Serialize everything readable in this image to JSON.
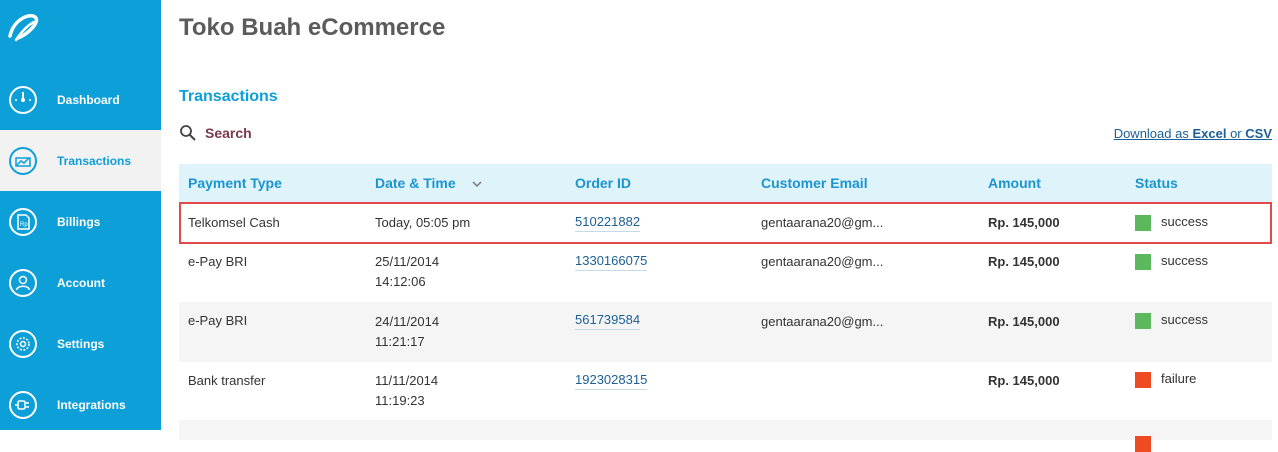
{
  "app": {
    "logo_icon": "swirl-logo-icon",
    "title": "Toko Buah eCommerce"
  },
  "sidebar": {
    "items": [
      {
        "label": "Dashboard",
        "icon": "gauge-icon",
        "active": false
      },
      {
        "label": "Transactions",
        "icon": "trend-chart-icon",
        "active": true
      },
      {
        "label": "Billings",
        "icon": "bill-icon",
        "active": false
      },
      {
        "label": "Account",
        "icon": "user-icon",
        "active": false
      },
      {
        "label": "Settings",
        "icon": "gear-icon",
        "active": false
      },
      {
        "label": "Integrations",
        "icon": "plug-icon",
        "active": false
      }
    ]
  },
  "main": {
    "section_title": "Transactions",
    "search_label": "Search",
    "download": {
      "prefix": "Download as",
      "excel": "Excel",
      "or": "or",
      "csv": "CSV"
    }
  },
  "table": {
    "columns": [
      "Payment Type",
      "Date & Time",
      "Order ID",
      "Customer Email",
      "Amount",
      "Status"
    ],
    "sorted_column": "Date & Time",
    "rows": [
      {
        "payment_type": "Telkomsel Cash",
        "date": "Today, 05:05 pm",
        "time": "",
        "order_id": "510221882",
        "email": "gentaarana20@gm...",
        "amount": "Rp. 145,000",
        "status": "success"
      },
      {
        "payment_type": "e-Pay BRI",
        "date": "25/11/2014",
        "time": "14:12:06",
        "order_id": "1330166075",
        "email": "gentaarana20@gm...",
        "amount": "Rp. 145,000",
        "status": "success"
      },
      {
        "payment_type": "e-Pay BRI",
        "date": "24/11/2014",
        "time": "11:21:17",
        "order_id": "561739584",
        "email": "gentaarana20@gm...",
        "amount": "Rp. 145,000",
        "status": "success"
      },
      {
        "payment_type": "Bank transfer",
        "date": "11/11/2014",
        "time": "11:19:23",
        "order_id": "1923028315",
        "email": "",
        "amount": "Rp. 145,000",
        "status": "failure"
      }
    ]
  },
  "colors": {
    "sidebar": "#0d9fd8",
    "success": "#5cb85c",
    "failure": "#ef4b23",
    "highlight": "#e04a4a"
  }
}
